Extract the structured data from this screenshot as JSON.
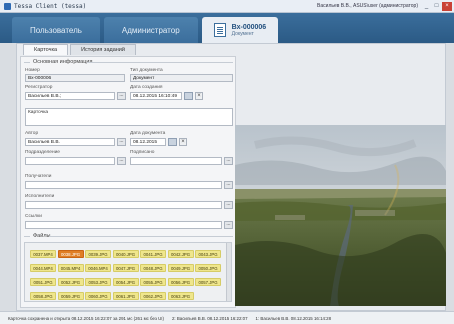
{
  "window": {
    "title": "Tessa Client (tessa)",
    "user": "Васильев В.В., ASUS\\user (администратор)",
    "minimize": "_",
    "maximize": "□",
    "close": "×"
  },
  "nav": {
    "tabs": [
      {
        "label": "Пользователь"
      },
      {
        "label": "Администратор"
      }
    ],
    "active": {
      "title": "Вх-000006",
      "subtitle": "Документ"
    }
  },
  "inner_tabs": [
    "Карточка",
    "История заданий"
  ],
  "form": {
    "group_title": "Основная информация",
    "number_label": "Номер",
    "number_value": "Вх-000006",
    "doctype_label": "Тип документа",
    "doctype_value": "Документ",
    "registrar_label": "Регистратор",
    "registrar_value": "Васильев В.В.;",
    "created_label": "Дата создания",
    "created_value": "08.12.2015  16:10:49",
    "note_value": "Карточка",
    "author_label": "Автор",
    "author_value": "Васильев В.В.",
    "docdate_label": "Дата документа",
    "docdate_value": "08.12.2015",
    "division_label": "Подразделение",
    "signer_label": "Подписано",
    "recipients_label": "Получатели",
    "executors_label": "Исполнители",
    "links_label": "Ссылки",
    "files_title": "Файлы",
    "ellipsis": "...",
    "clear": "×"
  },
  "files": [
    "0037.MP4",
    "0038.JPG",
    "0039.JPG",
    "0040.JPG",
    "0041.JPG",
    "0042.JPG",
    "0043.JPG",
    "0044.MP4",
    "0045.MP4",
    "0046.MP4",
    "0047.JPG",
    "0048.JPG",
    "0049.JPG",
    "0050.JPG",
    "0051.JPG",
    "0052.JPG",
    "0053.JPG",
    "0054.JPG",
    "0055.JPG",
    "0056.JPG",
    "0057.JPG",
    "0058.JPG",
    "0059.JPG",
    "0060.JPG",
    "0061.JPG",
    "0062.JPG",
    "0063.JPG"
  ],
  "selected_file": "0038.JPG",
  "status": {
    "saved": "Карточка сохранена и открыта 08.12.2015 16:22:07 за 291 мс (261 мс без UI)",
    "item2": "2:  Васильев В.В. 08.12.2015 16:22:07",
    "item1": "1:  Васильев В.В. 08.12.2015 16:14:28"
  },
  "colors": {
    "nav_bg": "#2b5a85",
    "chip_bg": "#efe68c",
    "chip_selected": "#e07e25"
  }
}
